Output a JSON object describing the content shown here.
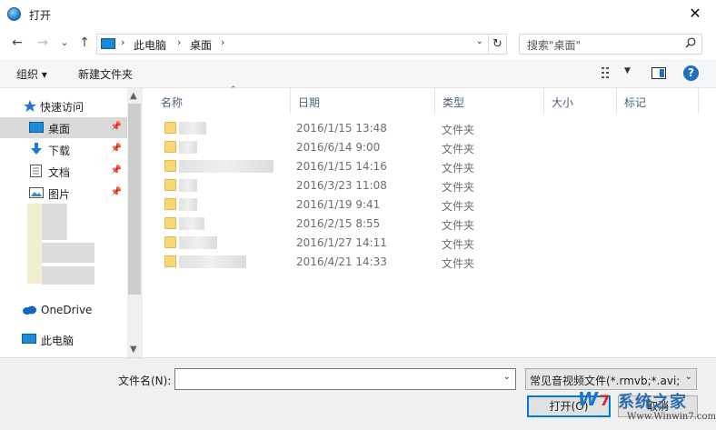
{
  "window": {
    "title": "打开",
    "close_glyph": "✕"
  },
  "address": {
    "back": "←",
    "forward": "→",
    "recent": "⌄",
    "up": "↑",
    "crumbs": [
      "此电脑",
      "桌面"
    ],
    "sep": "›",
    "dropdown": "⌄",
    "refresh": "↻"
  },
  "search": {
    "placeholder": "搜索\"桌面\""
  },
  "toolbar": {
    "organize": "组织 ▾",
    "new_folder": "新建文件夹",
    "help": "?"
  },
  "nav": {
    "quick_access": "快速访问",
    "items": [
      {
        "label": "桌面",
        "icon": "desktop-icon"
      },
      {
        "label": "下载",
        "icon": "download-icon"
      },
      {
        "label": "文档",
        "icon": "document-icon"
      },
      {
        "label": "图片",
        "icon": "pictures-icon"
      }
    ],
    "onedrive": "OneDrive",
    "this_pc": "此电脑",
    "pin": "📌"
  },
  "columns": {
    "name": "名称",
    "date": "日期",
    "type": "类型",
    "size": "大小",
    "tags": "标记"
  },
  "files": [
    {
      "date": "2016/1/15 13:48",
      "type": "文件夹"
    },
    {
      "date": "2016/6/14 9:00",
      "type": "文件夹"
    },
    {
      "date": "2016/1/15 14:16",
      "type": "文件夹"
    },
    {
      "date": "2016/3/23 11:08",
      "type": "文件夹"
    },
    {
      "date": "2016/1/19 9:41",
      "type": "文件夹"
    },
    {
      "date": "2016/2/15 8:55",
      "type": "文件夹"
    },
    {
      "date": "2016/1/27 14:11",
      "type": "文件夹"
    },
    {
      "date": "2016/4/21 14:33",
      "type": "文件夹"
    }
  ],
  "bottom": {
    "filename_label": "文件名(N):",
    "filename_value": "",
    "filter": "常见音视频文件(*.rmvb;*.avi;*.",
    "open_button": "打开(O)",
    "cancel_button": "取消"
  },
  "watermark": {
    "brand": "系统之家",
    "w": "W",
    "seven": "7",
    "url": "Www.Winwin7.com"
  }
}
